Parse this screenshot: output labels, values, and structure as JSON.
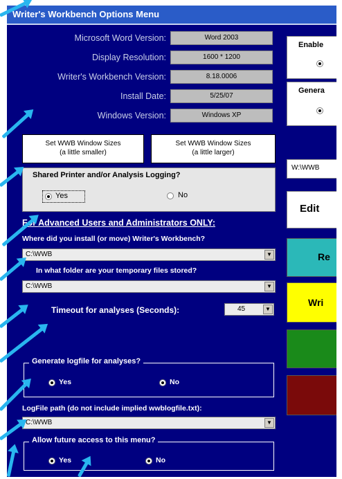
{
  "window": {
    "title": "Writer's Workbench Options Menu"
  },
  "info": [
    {
      "label": "Microsoft Word Version:",
      "value": "Word 2003"
    },
    {
      "label": "Display Resolution:",
      "value": "1600 * 1200"
    },
    {
      "label": "Writer's Workbench Version:",
      "value": "8.18.0006"
    },
    {
      "label": "Install Date:",
      "value": "5/25/07"
    },
    {
      "label": "Windows Version:",
      "value": "Windows XP"
    }
  ],
  "buttons": {
    "smaller": "Set WWB Window Sizes\n(a little smaller)",
    "larger": "Set WWB Window Sizes\n(a little larger)"
  },
  "logging": {
    "title": "Shared Printer and/or Analysis Logging?",
    "yes": "Yes",
    "no": "No",
    "selected": "yes"
  },
  "advanced": {
    "heading": "For Advanced Users and Administrators ONLY:",
    "install_label": "Where did you install (or move) Writer's Workbench?",
    "install_value": "C:\\WWB",
    "temp_label": "In what folder are your temporary files stored?",
    "temp_value": "C:\\WWB",
    "timeout_label": "Timeout for analyses (Seconds):",
    "timeout_value": "45",
    "logfile_frame": "Generate logfile for analyses?",
    "logfile_yes": "Yes",
    "logfile_no": "No",
    "logpath_label": "LogFile path (do not include implied wwblogfile.txt):",
    "logpath_value": "C:\\WWB",
    "access_frame": "Allow future access to this menu?",
    "access_yes": "Yes",
    "access_no": "No"
  },
  "right_panel": {
    "enable_label": "Enable",
    "general_label": "Genera",
    "path_value": "W:\\WWB",
    "edit_label": "Edit",
    "teal_label": "Re",
    "yellow_label": "Wri"
  },
  "colors": {
    "window_bg": "#000080",
    "title_bar": "#2a5cc8",
    "arrow": "#29b6ef",
    "teal": "#2bb8b8",
    "yellow": "#ffff00",
    "green": "#1a8a1a",
    "maroon": "#7a0a0a"
  }
}
